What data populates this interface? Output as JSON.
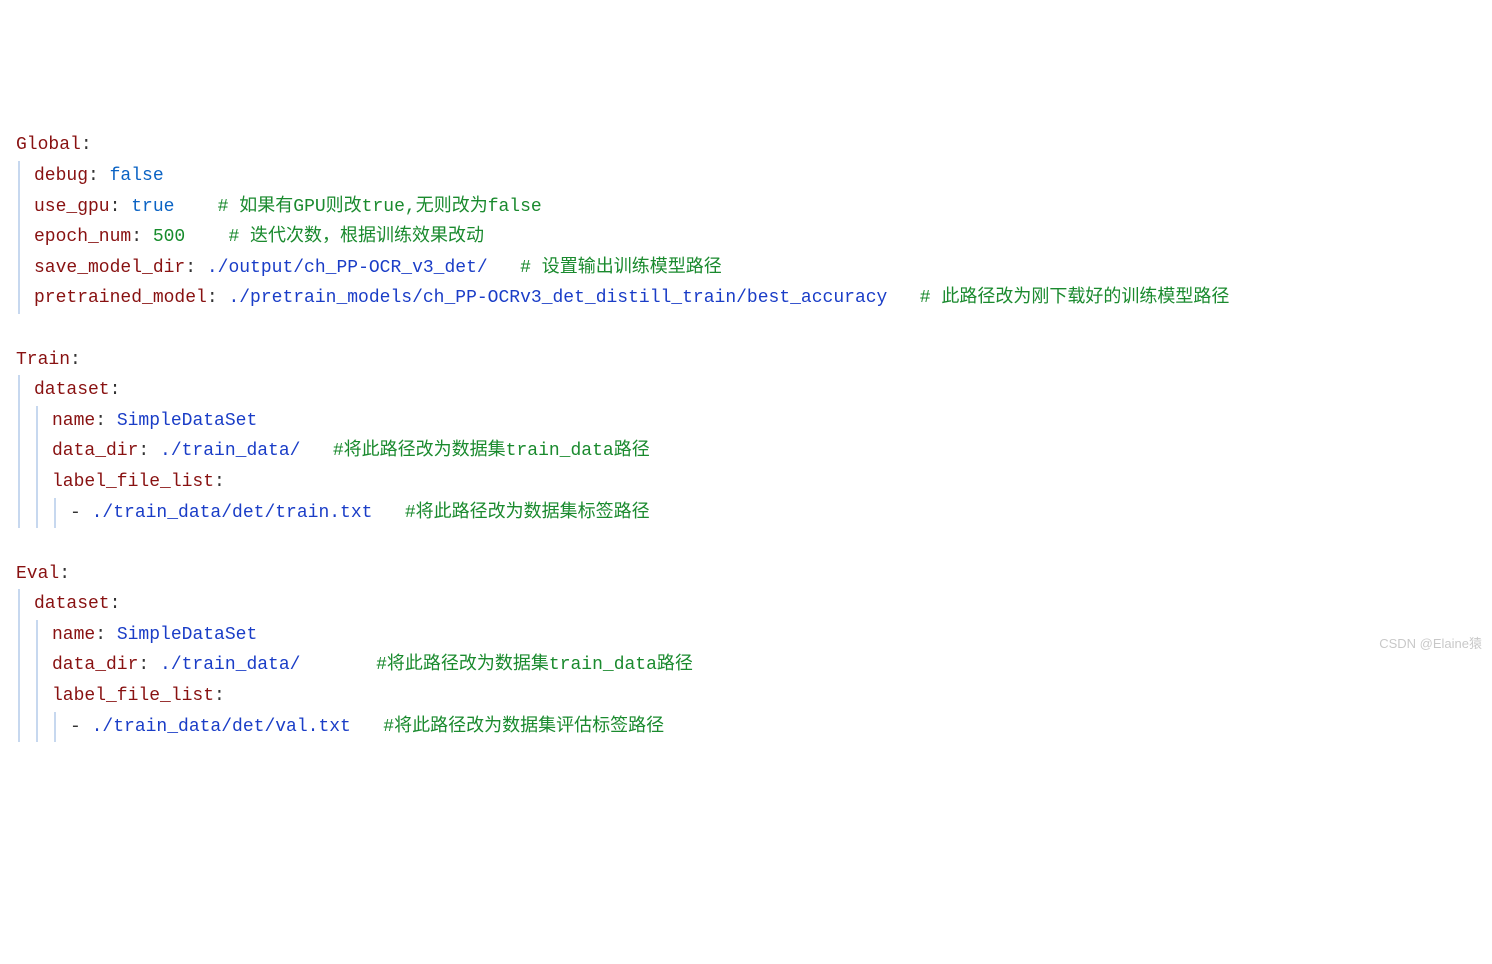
{
  "global": {
    "key": "Global",
    "debug": {
      "k": "debug",
      "v": "false"
    },
    "use_gpu": {
      "k": "use_gpu",
      "v": "true",
      "c": "# 如果有GPU则改true,无则改为false"
    },
    "epoch_num": {
      "k": "epoch_num",
      "v": "500",
      "c": "# 迭代次数，根据训练效果改动"
    },
    "save_model_dir": {
      "k": "save_model_dir",
      "v": "./output/ch_PP-OCR_v3_det/",
      "c": "# 设置输出训练模型路径"
    },
    "pretrained_model": {
      "k": "pretrained_model",
      "v": "./pretrain_models/ch_PP-OCRv3_det_distill_train/best_accuracy",
      "c": "# 此路径改为刚下载好的训练模型路径"
    }
  },
  "train": {
    "key": "Train",
    "dataset_key": "dataset",
    "name": {
      "k": "name",
      "v": "SimpleDataSet"
    },
    "data_dir": {
      "k": "data_dir",
      "v": "./train_data/",
      "c": "#将此路径改为数据集train_data路径"
    },
    "label_file_list": {
      "k": "label_file_list"
    },
    "label_item": {
      "v": "./train_data/det/train.txt",
      "c": "#将此路径改为数据集标签路径"
    }
  },
  "eval": {
    "key": "Eval",
    "dataset_key": "dataset",
    "name": {
      "k": "name",
      "v": "SimpleDataSet"
    },
    "data_dir": {
      "k": "data_dir",
      "v": "./train_data/",
      "c": "#将此路径改为数据集train_data路径"
    },
    "label_file_list": {
      "k": "label_file_list"
    },
    "label_item": {
      "v": "./train_data/det/val.txt",
      "c": "#将此路径改为数据集评估标签路径"
    }
  },
  "watermark": "CSDN @Elaine猿"
}
